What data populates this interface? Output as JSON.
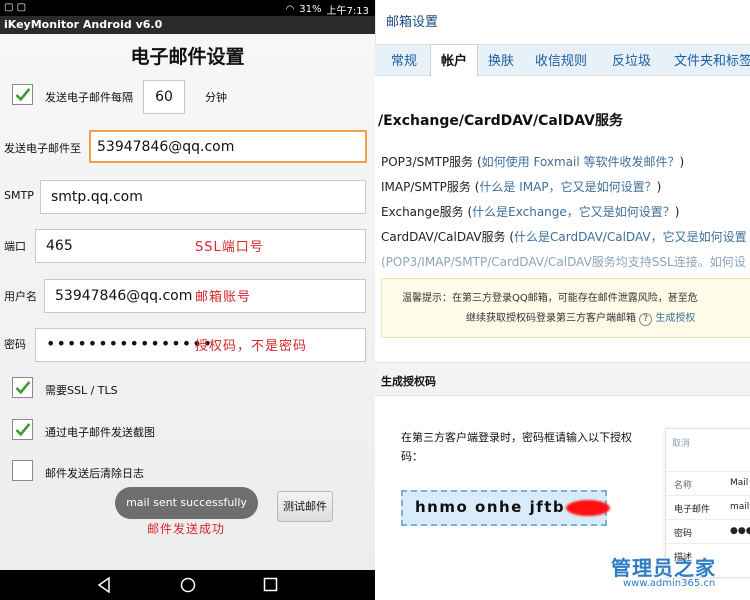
{
  "android": {
    "status": {
      "time": "上午7:13",
      "battery": "31%"
    },
    "app_title": "iKeyMonitor Android v6.0",
    "page_title": "电子邮件设置",
    "interval": {
      "label": "发送电子邮件每隔",
      "value": "60",
      "unit": "分钟",
      "checked": true
    },
    "email_to": {
      "label": "发送电子邮件至",
      "value": "53947846@qq.com"
    },
    "smtp": {
      "label": "SMTP",
      "value": "smtp.qq.com"
    },
    "port": {
      "label": "端口",
      "value": "465",
      "note": "SSL端口号"
    },
    "username": {
      "label": "用户名",
      "value": "53947846@qq.com",
      "note": "邮箱账号"
    },
    "password": {
      "label": "密码",
      "value": "••••••••••••••••",
      "note": "授权码，不是密码"
    },
    "ssl": {
      "label": "需要SSL / TLS",
      "checked": true
    },
    "screenshot": {
      "label": "通过电子邮件发送截图",
      "checked": true
    },
    "clear_log": {
      "label": "邮件发送后清除日志",
      "checked": false
    },
    "toast": "mail sent successfully",
    "test_button": "测试邮件",
    "success_note": "邮件发送成功"
  },
  "qqmail": {
    "header_title": "邮箱设置",
    "tabs": [
      {
        "label": "常规"
      },
      {
        "label": "帐户",
        "active": true
      },
      {
        "label": "换肤"
      },
      {
        "label": "收信规则"
      },
      {
        "label": "反垃圾"
      },
      {
        "label": "文件夹和标签"
      }
    ],
    "section_title": "/Exchange/CardDAV/CalDAV服务",
    "services": [
      {
        "name": "POP3/SMTP服务",
        "open": " (",
        "link": "如何使用 Foxmail 等软件收发邮件？",
        "close": ")"
      },
      {
        "name": "IMAP/SMTP服务",
        "open": " (",
        "link": "什么是 IMAP，它又是如何设置？",
        "close": ")"
      },
      {
        "name": "Exchange服务",
        "open": " (",
        "link": "什么是Exchange，它又是如何设置？",
        "close": ")"
      },
      {
        "name": "CardDAV/CalDAV服务",
        "open": " (",
        "link": "什么是CardDAV/CalDAV，它又是如何设置",
        "close": ""
      }
    ],
    "ssl_note": "(POP3/IMAP/SMTP/CardDAV/CalDAV服务均支持SSL连接。如何设",
    "warning": {
      "line1": "温馨提示：在第三方登录QQ邮箱，可能存在邮件泄露风险，甚至危",
      "line2": "继续获取授权码登录第三方客户端邮箱",
      "qmark": "?",
      "link": "生成授权"
    },
    "gen_title": "生成授权码",
    "instruction": "在第三方客户端登录时，密码框请输入以下授权码：",
    "auth_code": "hnmo onhe jftb",
    "mini": {
      "cancel": "取消",
      "rows": [
        {
          "label": "名称",
          "value": "Mail"
        },
        {
          "label": "电子邮件",
          "value": "mailt"
        },
        {
          "label": "密码",
          "value": "●●●●"
        },
        {
          "label": "描述",
          "value": ""
        }
      ]
    },
    "watermark": {
      "text": "管理员之家",
      "url": "www.admin365.cn"
    }
  },
  "colors": {
    "accent_orange": "#f0a04b",
    "note_red": "#d4272b",
    "link_blue": "#3d6f9c",
    "check_green": "#3c9a2f"
  }
}
